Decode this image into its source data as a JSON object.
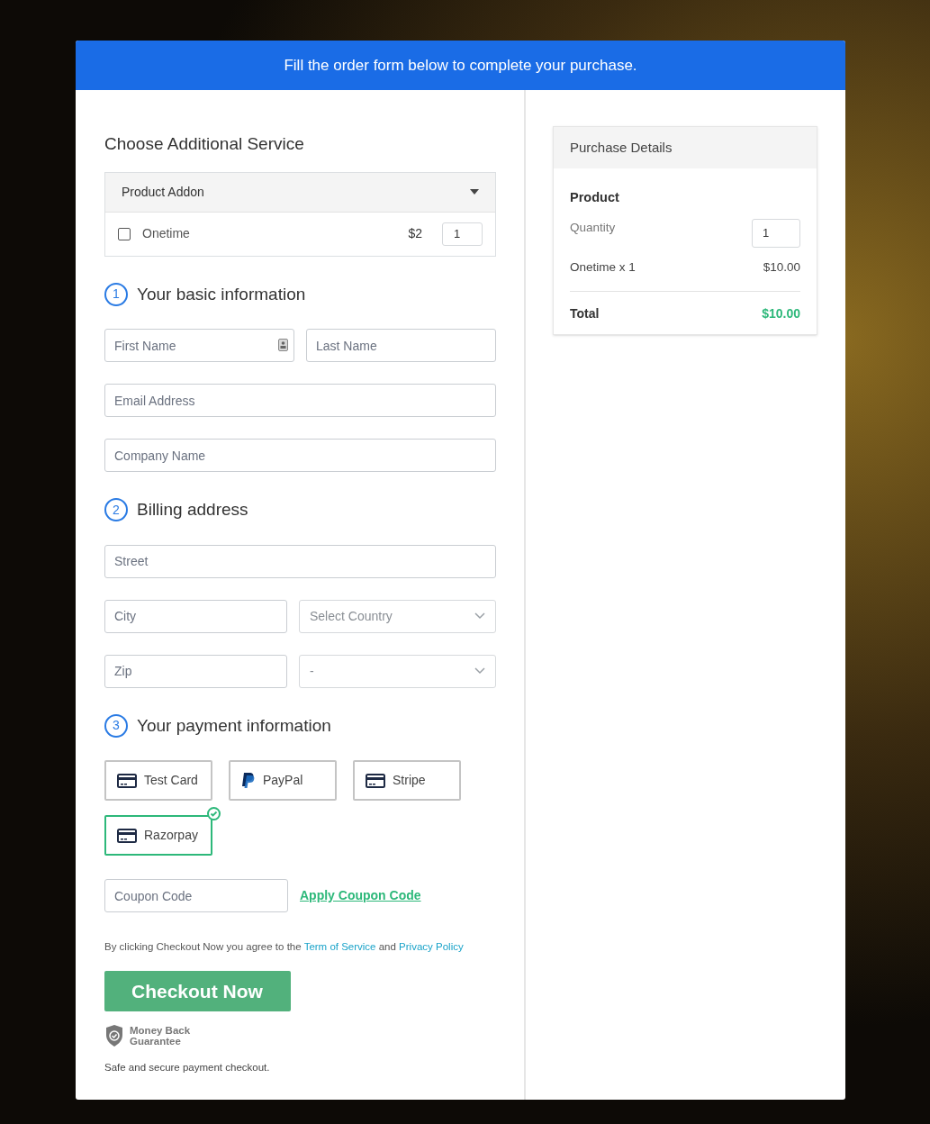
{
  "banner": "Fill the order form below to complete your purchase.",
  "addon": {
    "title": "Choose Additional Service",
    "header": "Product Addon",
    "expanded": true,
    "item": {
      "label": "Onetime",
      "checked": false,
      "price": "$2",
      "quantity": "1"
    }
  },
  "sections": [
    {
      "number": "1",
      "title": "Your basic information",
      "rows": [
        [
          {
            "kind": "text",
            "placeholder": "First Name",
            "contact_icon": true
          },
          {
            "kind": "text",
            "placeholder": "Last Name"
          }
        ],
        [
          {
            "kind": "text",
            "placeholder": "Email Address"
          }
        ],
        [
          {
            "kind": "text",
            "placeholder": "Company Name"
          }
        ]
      ]
    },
    {
      "number": "2",
      "title": "Billing address",
      "rows": [
        [
          {
            "kind": "text",
            "placeholder": "Street"
          }
        ],
        [
          {
            "kind": "text",
            "placeholder": "City"
          },
          {
            "kind": "select",
            "value": "Select Country"
          }
        ],
        [
          {
            "kind": "text",
            "placeholder": "Zip"
          },
          {
            "kind": "select",
            "value": "-"
          }
        ]
      ]
    },
    {
      "number": "3",
      "title": "Your payment information"
    }
  ],
  "payment_methods": [
    {
      "kind": "card",
      "label": "Test Card",
      "selected": false
    },
    {
      "kind": "paypal",
      "label": "PayPal",
      "selected": false
    },
    {
      "kind": "card",
      "label": "Stripe",
      "selected": false
    },
    {
      "kind": "card",
      "label": "Razorpay",
      "selected": true
    }
  ],
  "coupon": {
    "placeholder": "Coupon Code",
    "apply": "Apply Coupon Code"
  },
  "terms": {
    "before": "By clicking Checkout Now you agree to the",
    "link1": "Term of Service",
    "middle": "and",
    "link2": "Privacy Policy"
  },
  "checkout": "Checkout Now",
  "guarantee": "Money Back Guarantee",
  "secure_note": "Safe and secure payment checkout.",
  "summary": {
    "title": "Purchase Details",
    "product_label": "Product",
    "quantity_label": "Quantity",
    "quantity": "1",
    "line_item": "Onetime x 1",
    "line_price": "$10.00",
    "total_label": "Total",
    "total": "$10.00"
  }
}
